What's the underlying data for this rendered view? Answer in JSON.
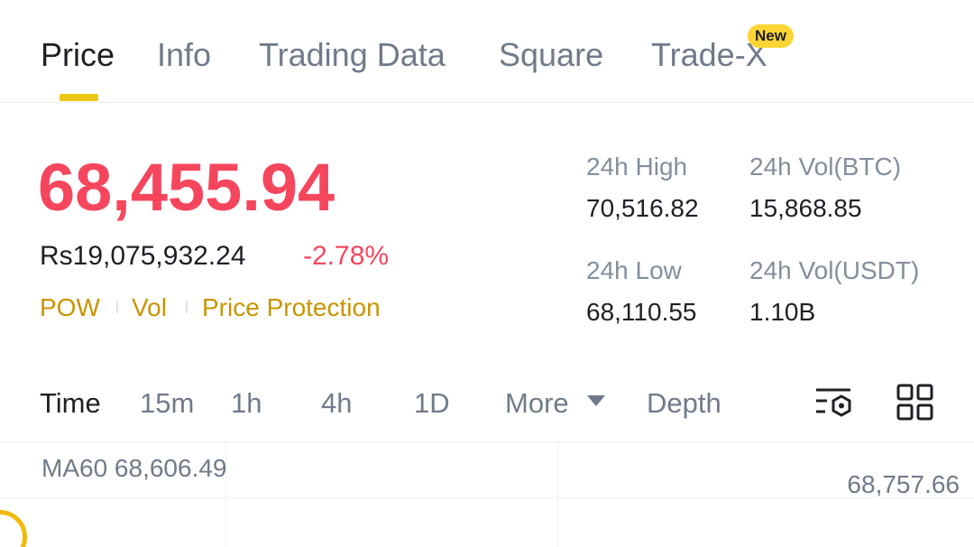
{
  "tabs": [
    {
      "label": "Price",
      "active": true
    },
    {
      "label": "Info",
      "active": false
    },
    {
      "label": "Trading Data",
      "active": false
    },
    {
      "label": "Square",
      "active": false
    },
    {
      "label": "Trade-X",
      "active": false,
      "badge": "New"
    }
  ],
  "ticker": {
    "last_price": "68,455.94",
    "fiat_price": "Rs19,075,932.24",
    "change_pct": "-2.78%",
    "tags": [
      "POW",
      "Vol",
      "Price Protection"
    ]
  },
  "stats": {
    "high_label": "24h High",
    "high_value": "70,516.82",
    "vol_btc_label": "24h Vol(BTC)",
    "vol_btc_value": "15,868.85",
    "low_label": "24h Low",
    "low_value": "68,110.55",
    "vol_usdt_label": "24h Vol(USDT)",
    "vol_usdt_value": "1.10B"
  },
  "timeframes": {
    "items": [
      "Time",
      "15m",
      "1h",
      "4h",
      "1D"
    ],
    "active": "Time",
    "more_label": "More",
    "depth_label": "Depth"
  },
  "chart": {
    "ma_label": "MA60 68,606.49",
    "axis_value": "68,757.66"
  },
  "colors": {
    "down": "#f6465d",
    "accent": "#f0c712",
    "tag": "#c99400"
  },
  "icons": [
    "chart-settings-icon",
    "grid-layout-icon",
    "chevron-down-icon"
  ]
}
